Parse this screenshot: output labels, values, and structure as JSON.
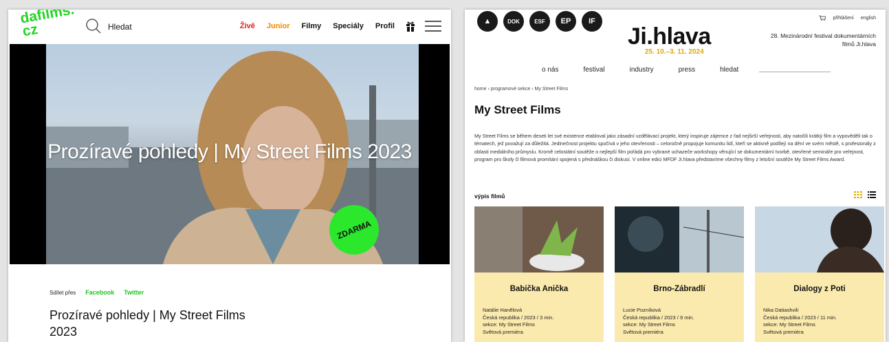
{
  "dafilms": {
    "logo_line1": "dafilms.",
    "logo_line2": "cz",
    "search_label": "Hledat",
    "nav": [
      {
        "label": "Živě",
        "color": "#e02020"
      },
      {
        "label": "Junior",
        "color": "#f08a00"
      },
      {
        "label": "Filmy",
        "color": "#111111"
      },
      {
        "label": "Speciály",
        "color": "#111111"
      },
      {
        "label": "Profil",
        "color": "#111111"
      }
    ],
    "hero_title": "Prozíravé pohledy | My Street Films 2023",
    "badge": "ZDARMA",
    "share_label": "Sdílet přes",
    "share_facebook": "Facebook",
    "share_twitter": "Twitter",
    "page_title": "Prozíravé pohledy | My Street Films 2023",
    "accent_color": "#2ce82c"
  },
  "jihlava": {
    "badges": [
      "▲",
      "DOK",
      "ESF",
      "EP",
      "IF"
    ],
    "logo": "Ji.hlava",
    "dates": "25. 10.–3. 11. 2024",
    "top_links": {
      "login": "přihlášení",
      "lang": "english"
    },
    "festival_name": "28. Mezinárodní festival dokumentárních filmů Ji.hlava",
    "nav": [
      "o nás",
      "festival",
      "industry",
      "press",
      "hledat"
    ],
    "breadcrumb": "home  ›  programové sekce  ›  My Street Films",
    "title": "My Street Films",
    "description": "My Street Films se během deseti let své existence etabloval jako zásadní vzdělávací projekt, který inspiruje zájemce z řad nejširší veřejnosti, aby natočili krátký film a vypověděli tak o tématech, jež považují za důležitá. Jedinečnost projektu spočívá v jeho otevřenosti – celoročně propojuje komunitu lidí, kteří se aktivně podílejí na dění ve svém městě, s profesionály z oblasti mediálního průmyslu. Kromě celostátní soutěže o nejlepší film pořádá pro vybrané uchazeče workshopy věnující se dokumentární tvorbě, otevřené semináře pro veřejnost, program pro školy či filmová promítání spojená s přednáškou či diskusí. V online edici MFDF Ji.hlava představíme všechny filmy z letošní soutěže My Street Films Award.",
    "list_label": "výpis filmů",
    "card_color": "#fbeaae",
    "films": [
      {
        "title": "Babička Anička",
        "author": "Natálie Hanělová",
        "info": "Česká republika / 2023 / 3 min.",
        "section": "sekce: My Street Films",
        "premiere": "Světová premiéra"
      },
      {
        "title": "Brno-Zábradlí",
        "author": "Lucie Pozníková",
        "info": "Česká republika / 2023 / 9 min.",
        "section": "sekce: My Street Films",
        "premiere": "Světová premiéra"
      },
      {
        "title": "Dialogy z Poti",
        "author": "Nika Datiashvili",
        "info": "Česká republika / 2023 / 11 min.",
        "section": "sekce: My Street Films",
        "premiere": "Světová premiéra"
      }
    ]
  }
}
